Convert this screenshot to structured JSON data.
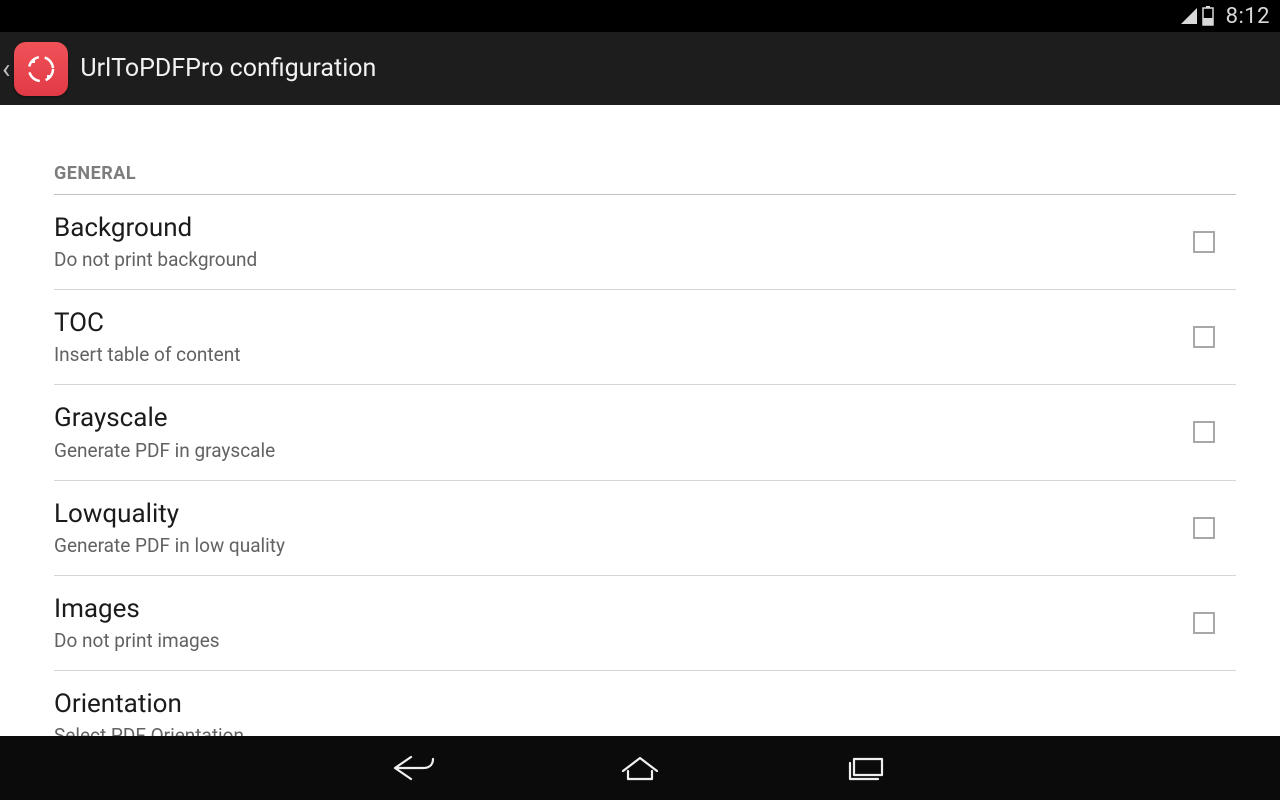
{
  "status_bar": {
    "clock": "8:12"
  },
  "action_bar": {
    "title": "UrlToPDFPro configuration"
  },
  "settings": {
    "section_header": "GENERAL",
    "rows": {
      "background": {
        "title": "Background",
        "subtitle": "Do not print background",
        "has_checkbox": true
      },
      "toc": {
        "title": "TOC",
        "subtitle": "Insert table of content",
        "has_checkbox": true
      },
      "grayscale": {
        "title": "Grayscale",
        "subtitle": "Generate PDF in grayscale",
        "has_checkbox": true
      },
      "lowquality": {
        "title": "Lowquality",
        "subtitle": "Generate PDF in low quality",
        "has_checkbox": true
      },
      "images": {
        "title": "Images",
        "subtitle": "Do not print images",
        "has_checkbox": true
      },
      "orientation": {
        "title": "Orientation",
        "subtitle": "Select PDF Orientation",
        "has_checkbox": false
      }
    }
  }
}
